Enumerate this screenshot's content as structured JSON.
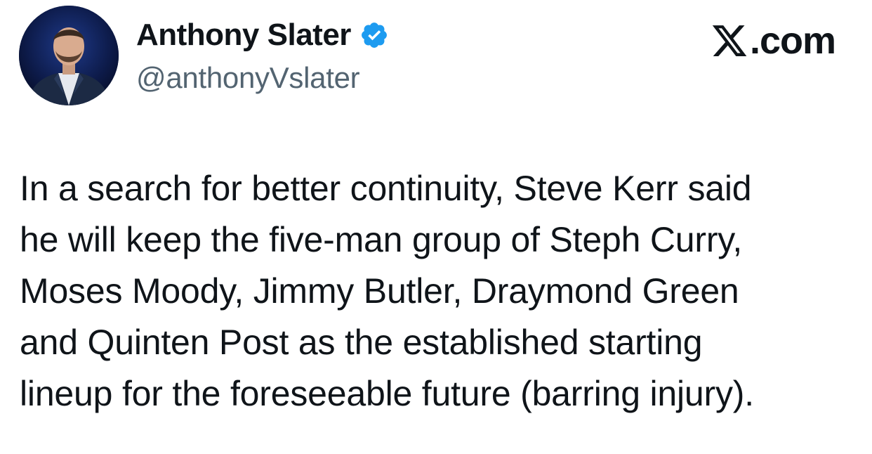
{
  "author": {
    "display_name": "Anthony Slater",
    "handle": "@anthonyVslater",
    "verified": true,
    "avatar_icon": "avatar-photo",
    "verified_icon": "verified-badge-icon",
    "verified_color": "#1d9bf0"
  },
  "brand": {
    "icon": "x-logo-icon",
    "label": ".com"
  },
  "tweet": {
    "lines": [
      "In a search for better continuity, Steve Kerr said",
      "he will keep the five-man group of Steph Curry,",
      "Moses Moody, Jimmy Butler, Draymond Green",
      "and Quinten Post as the established starting",
      "lineup for the foreseeable future (barring injury)."
    ]
  },
  "colors": {
    "text_primary": "#0f1419",
    "text_secondary": "#536471",
    "background": "#ffffff"
  }
}
